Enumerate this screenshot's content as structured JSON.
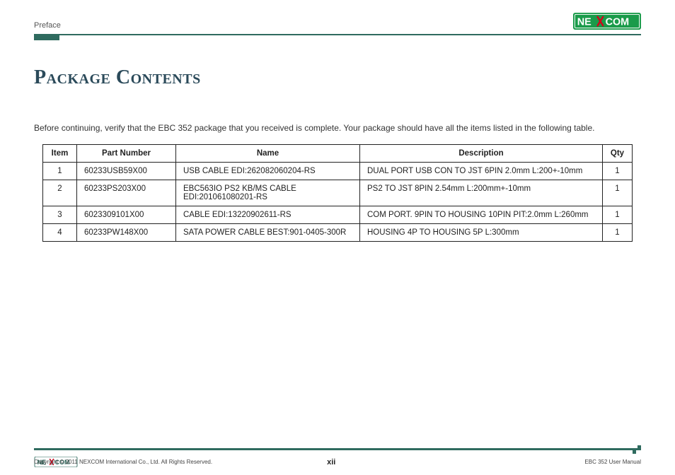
{
  "header": {
    "section": "Preface",
    "logo_text_left": "NE",
    "logo_text_right": "COM"
  },
  "title": "Package Contents",
  "intro": "Before continuing, verify that the EBC 352 package that you received is complete. Your package should have all the items listed in the following table.",
  "table": {
    "headers": {
      "item": "Item",
      "part": "Part Number",
      "name": "Name",
      "desc": "Description",
      "qty": "Qty"
    },
    "rows": [
      {
        "item": "1",
        "part": "60233USB59X00",
        "name": "USB CABLE EDI:262082060204-RS",
        "desc": "DUAL PORT USB CON TO JST 6PIN 2.0mm L:200+-10mm",
        "qty": "1"
      },
      {
        "item": "2",
        "part": "60233PS203X00",
        "name": "EBC563IO PS2 KB/MS CABLE EDI:201061080201-RS",
        "desc": "PS2 TO JST 8PIN 2.54mm L:200mm+-10mm",
        "qty": "1"
      },
      {
        "item": "3",
        "part": "6023309101X00",
        "name": "CABLE EDI:13220902611-RS",
        "desc": "COM PORT. 9PIN TO HOUSING 10PIN PIT:2.0mm L:260mm",
        "qty": "1"
      },
      {
        "item": "4",
        "part": "60233PW148X00",
        "name": "SATA POWER CABLE BEST:901-0405-300R",
        "desc": "HOUSING 4P TO HOUSING 5P L:300mm",
        "qty": "1"
      }
    ]
  },
  "footer": {
    "copyright": "Copyright © 2011 NEXCOM International Co., Ltd. All Rights Reserved.",
    "page_num": "xii",
    "manual": "EBC 352 User Manual"
  }
}
